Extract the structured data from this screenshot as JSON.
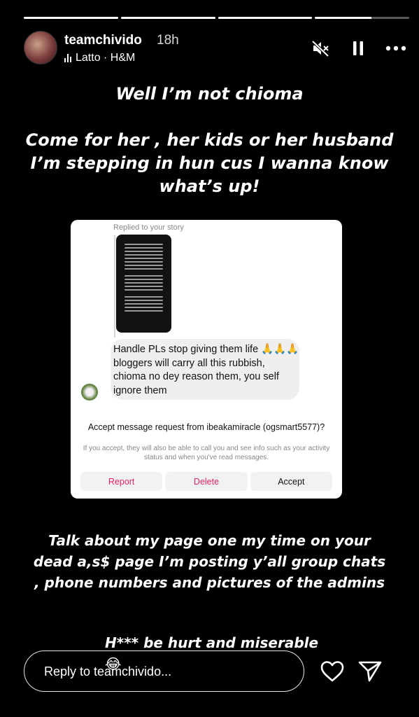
{
  "progress": {
    "segments": 4,
    "filled": [
      1,
      1,
      1,
      0.6
    ]
  },
  "header": {
    "username": "teamchivido",
    "time_ago": "18h",
    "music": "Latto · H&M"
  },
  "captions": {
    "top": "Well I’m not chioma\n\nCome for her , her kids or her husband I’m stepping in hun cus I wanna know what’s up!",
    "bottom": "Talk about my page one my time on your dead a,s$ page I’m posting y’all group chats , phone numbers and pictures of the admins",
    "bottom2": "H*** be hurt and miserable 😂"
  },
  "screenshot": {
    "replied_label": "Replied to your story",
    "message": "Handle PLs stop giving them life 🙏🙏🙏 bloggers will carry all this rubbish, chioma no dey reason them, you self ignore them",
    "request_title": "Accept message request from ibeakamiracle (ogsmart5577)?",
    "request_sub": "If you accept, they will also be able to call you and see info such as your activity status and when you've read messages.",
    "buttons": {
      "report": "Report",
      "delete": "Delete",
      "accept": "Accept"
    }
  },
  "reply": {
    "placeholder": "Reply to teamchivido..."
  },
  "icons": [
    "mute-icon",
    "pause-icon",
    "more-icon",
    "heart-icon",
    "send-icon"
  ]
}
